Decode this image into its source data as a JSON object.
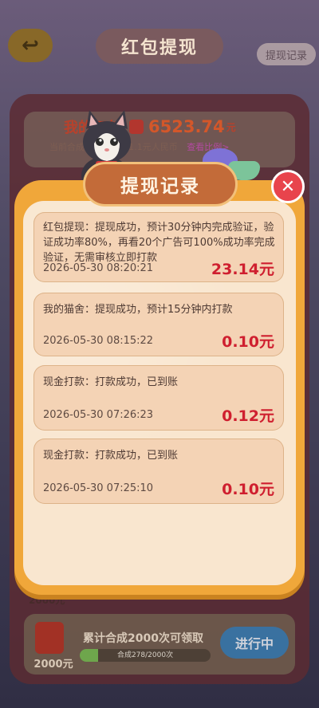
{
  "header": {
    "back_icon": "back-arrow-icon",
    "title": "红包提现",
    "records_link": "提现记录"
  },
  "balance": {
    "label": "我的红包",
    "amount": "6523.74",
    "unit": "元",
    "rate_text": "当前合成10000元=1.1元人民币",
    "rate_link": "查看比例>"
  },
  "modal": {
    "title": "提现记录",
    "close_icon": "close-icon",
    "records": [
      {
        "text": "红包提现：提现成功，预计30分钟内完成验证，验证成功率80%，再看20个广告可100%成功率完成验证，无需审核立即打款",
        "time": "2026-05-30 08:20:21",
        "amount": "23.14元"
      },
      {
        "text": "我的猫舍：提现成功，预计15分钟内打款",
        "time": "2026-05-30 08:15:22",
        "amount": "0.10元"
      },
      {
        "text": "现金打款：打款成功，已到账",
        "time": "2026-05-30 07:26:23",
        "amount": "0.12元"
      },
      {
        "text": "现金打款：打款成功，已到账",
        "time": "2026-05-30 07:25:10",
        "amount": "0.10元"
      }
    ]
  },
  "bottom_task": {
    "partial_amount": "2000元",
    "amount": "2000元",
    "task_label": "累计合成2000次可领取",
    "progress_text": "合成278/2000次",
    "progress_fraction": 0.139,
    "button_label": "进行中"
  },
  "colors": {
    "modal_border": "#f0a73a",
    "modal_body": "#f9e6cf",
    "record_bg": "#f4d3b5",
    "amount_red": "#cf1f2f",
    "title_brown": "#c36b39",
    "close_red": "#e8444c"
  }
}
